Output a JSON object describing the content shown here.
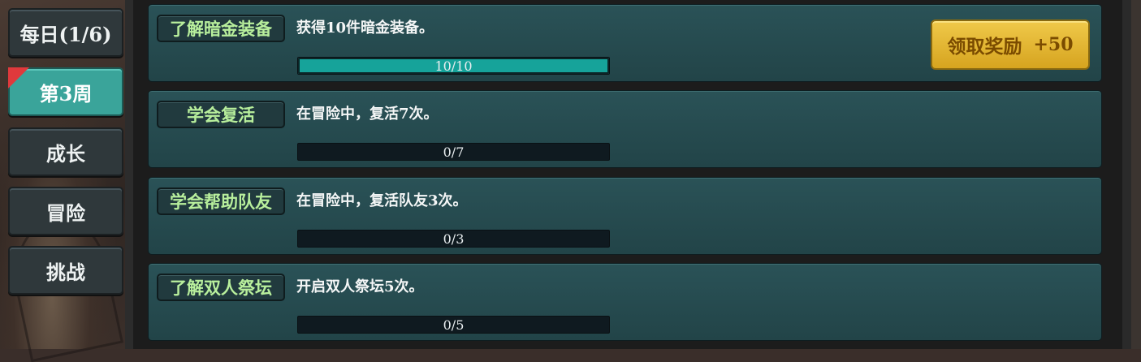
{
  "tabs": [
    {
      "label": "每日(1/6)",
      "active": false
    },
    {
      "label": "第3周",
      "active": true,
      "flag": true
    },
    {
      "label": "成长",
      "active": false
    },
    {
      "label": "冒险",
      "active": false
    },
    {
      "label": "挑战",
      "active": false
    }
  ],
  "tasks": [
    {
      "name": "了解暗金装备",
      "desc": "获得10件暗金装备。",
      "progress_text": "10/10",
      "progress": 1.0,
      "claim": {
        "label": "领取奖励",
        "bonus": "+50"
      }
    },
    {
      "name": "学会复活",
      "desc": "在冒险中，复活7次。",
      "progress_text": "0/7",
      "progress": 0.0
    },
    {
      "name": "学会帮助队友",
      "desc": "在冒险中，复活队友3次。",
      "progress_text": "0/3",
      "progress": 0.0
    },
    {
      "name": "了解双人祭坛",
      "desc": "开启双人祭坛5次。",
      "progress_text": "0/5",
      "progress": 0.0
    }
  ],
  "colors": {
    "accent_tab": "#3aa49a",
    "progress_fill": "#16a39a",
    "task_name": "#b8ef9c",
    "claim_button": "#e8bd36"
  }
}
